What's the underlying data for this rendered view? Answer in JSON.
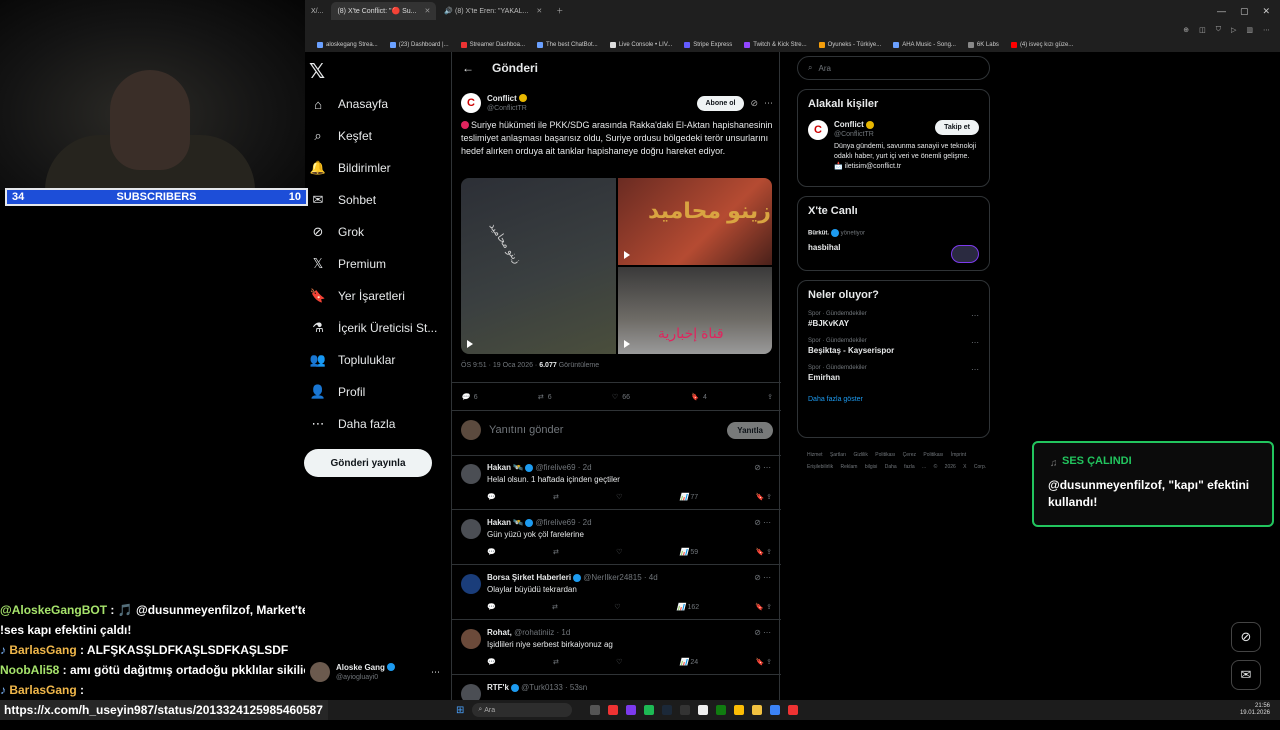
{
  "browser": {
    "tabs": [
      {
        "label": "X/..."
      },
      {
        "label": "(8) X'te Conflict: \"🔴 Su...",
        "active": true
      },
      {
        "label": "🔊 (8) X'te Eren: \"YAKAL..."
      }
    ],
    "window_controls": [
      "—",
      "▢",
      "✕"
    ],
    "bookmarks": [
      "aloskegang Strea...",
      "(23) Dashboard |...",
      "Streamer Dashboa...",
      "The best ChatBot...",
      "Live Console • LIV...",
      "Stripe Express",
      "Twitch & Kick Stre...",
      "Oyuneks - Türkiye...",
      "AHA Music - Song...",
      "6K Labs",
      "(4) isveç kızı güze..."
    ]
  },
  "stream": {
    "subscribers": {
      "left_count": "34",
      "label": "SUBSCRIBERS",
      "right_count": "10"
    },
    "alert": {
      "title": "SES ÇALINDI",
      "message": "@dusunmeyenfilzof, \"kapı\" efektini kullandı!"
    },
    "chat": [
      {
        "user": "@AloskeGangBOT",
        "text": " : 🎵 @dusunmeyenfilzof, Market'ten"
      },
      {
        "user": "",
        "text": "!ses kapı efektini çaldı!"
      },
      {
        "user": "BarlasGang",
        "text": " : ALFŞKASŞLDFKAŞLSDFKAŞLSDF"
      },
      {
        "user": "NoobAli58",
        "text": " : amı götü dağıtmış ortadoğu pkklılar sikilio"
      },
      {
        "user": "BarlasGang",
        "text": " :"
      }
    ],
    "url_tooltip": "https://x.com/h_useyin987/status/2013324125985460587"
  },
  "x": {
    "nav": [
      {
        "label": "Anasayfa",
        "icon": "⌂"
      },
      {
        "label": "Keşfet",
        "icon": "⌕"
      },
      {
        "label": "Bildirimler",
        "icon": "🔔"
      },
      {
        "label": "Sohbet",
        "icon": "✉"
      },
      {
        "label": "Grok",
        "icon": "⊘"
      },
      {
        "label": "Premium",
        "icon": "𝕏"
      },
      {
        "label": "Yer İşaretleri",
        "icon": "🔖"
      },
      {
        "label": "İçerik Üreticisi St...",
        "icon": "⚗"
      },
      {
        "label": "Topluluklar",
        "icon": "👥"
      },
      {
        "label": "Profil",
        "icon": "👤"
      },
      {
        "label": "Daha fazla",
        "icon": "⋯"
      }
    ],
    "post_button": "Gönderi yayınla",
    "account": {
      "name": "Aloske Gang",
      "handle": "@ayiogluayi0"
    },
    "page_title": "Gönderi",
    "tweet": {
      "author_name": "Conflict",
      "author_handle": "@ConflictTR",
      "subscribe_label": "Abone ol",
      "text": "Suriye hükümeti ile PKK/SDG arasında Rakka'daki El-Aktan hapishanesinin teslimiyet anlaşması başarısız oldu, Suriye ordusu bölgedeki terör unsurlarını hedef alırken orduya ait tanklar hapishaneye doğru hareket ediyor.",
      "media_overlay_1": "زينو محاميد",
      "media_overlay_2": "قناة إخبارية",
      "time": "ÖS 9:51 · 19 Oca 2026 · ",
      "views_count": "6.077",
      "views_label": " Görüntüleme",
      "stats": {
        "replies": "6",
        "reposts": "6",
        "likes": "66",
        "bookmarks": "4"
      }
    },
    "reply_box": {
      "placeholder": "Yanıtını gönder",
      "button": "Yanıtla"
    },
    "replies": [
      {
        "name": "Hakan 🛰️",
        "handle": "@firelive69 · 2d",
        "text": "Helal olsun. 1 haftada içinden geçtiler",
        "views": "77"
      },
      {
        "name": "Hakan 🛰️",
        "handle": "@firelive69 · 2d",
        "text": "Gün yüzü yok çöl farelerine",
        "views": "59"
      },
      {
        "name": "Borsa Şirket Haberleri",
        "handle": "@NerIlker24815 · 4d",
        "text": "Olaylar büyüdü tekrardan",
        "views": "162"
      },
      {
        "name": "Rohat,",
        "handle": "@rohatiniiz · 1d",
        "text": "Işidlileri niye serbest birkaiyonuz ag",
        "views": "24"
      },
      {
        "name": "RTF'k",
        "handle": "@Turk0133 · 53sn",
        "text": "",
        "views": ""
      }
    ],
    "search_placeholder": "Ara",
    "related": {
      "title": "Alakalı kişiler",
      "name": "Conflict",
      "handle": "@ConflictTR",
      "follow": "Takip et",
      "bio": "Dünya gündemi, savunma sanayii ve teknoloji odaklı haber, yurt içi veri ve önemli gelişme. 📩 iletisim@conflict.tr"
    },
    "live": {
      "title": "X'te Canlı",
      "host": "Bürküt.",
      "host_role": " yönetiyor",
      "space": "hasbihal"
    },
    "trends": {
      "title": "Neler oluyor?",
      "items": [
        {
          "category": "Spor · Gündemdekiler",
          "name": "#BJKvKAY"
        },
        {
          "category": "Spor · Gündemdekiler",
          "name": "Beşiktaş - Kayserispor"
        },
        {
          "category": "Spor · Gündemdekiler",
          "name": "Emirhan"
        }
      ],
      "show_more": "Daha fazla göster"
    },
    "footer": "Hizmet Şartları  Gizlilik Politikası  Çerez Politikası  İmprint  Erişilebilirlik  Reklam bilgisi  Daha fazla ...  © 2026 X Corp."
  },
  "taskbar": {
    "search_placeholder": "Ara",
    "time": "21:56",
    "date": "19.01.2026"
  },
  "colors": {
    "accent": "#1d9bf0",
    "alert_green": "#22c55e",
    "sub_blue": "#1d4ed8",
    "chat_user": "#a6e36b"
  }
}
